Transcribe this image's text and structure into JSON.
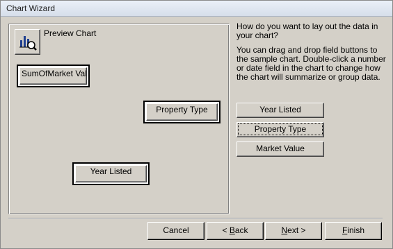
{
  "window": {
    "title": "Chart Wizard"
  },
  "preview": {
    "icon": "chart-preview-icon",
    "label": "Preview Chart",
    "data_field": "SumOfMarket Value",
    "series_field": "Property Type",
    "axis_field": "Year Listed"
  },
  "instructions": {
    "question": "How do you want to lay out the data in your chart?",
    "help": "You can drag and drop field buttons to the sample chart. Double-click a number or date field in the chart to change how the chart will summarize or group data."
  },
  "fields": [
    {
      "label": "Year Listed"
    },
    {
      "label": "Property Type"
    },
    {
      "label": "Market Value"
    }
  ],
  "buttons": {
    "cancel": "Cancel",
    "back_mnemonic": "B",
    "back_rest": "ack",
    "back_prefix": "< ",
    "next_mnemonic": "N",
    "next_rest": "ext >",
    "finish_mnemonic": "F",
    "finish_rest": "inish"
  }
}
